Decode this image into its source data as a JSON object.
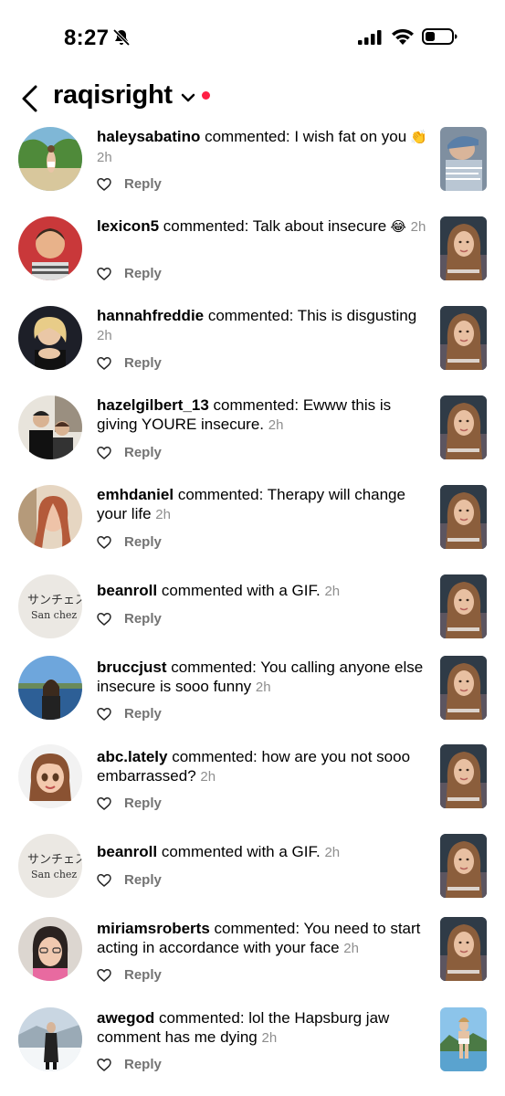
{
  "status_bar": {
    "time": "8:27",
    "silent_icon": "bell-slash-icon",
    "signal_icon": "cellular-signal-icon",
    "wifi_icon": "wifi-icon",
    "battery_icon": "battery-low-icon"
  },
  "header": {
    "back_icon": "chevron-left-icon",
    "title": "raqisright",
    "dropdown_icon": "chevron-down-icon",
    "notification_dot_color": "#ff1f44"
  },
  "colors": {
    "timestamp": "#8e8e8e",
    "reply": "#737373"
  },
  "notifications": [
    {
      "username": "haleysabatino",
      "action": " commented: I wish fat on you",
      "emoji": "👏",
      "time": "2h",
      "reply": "Reply"
    },
    {
      "username": "lexicon5",
      "action": " commented: Talk about insecure",
      "emoji": "😂",
      "time": "2h",
      "reply": "Reply"
    },
    {
      "username": "hannahfreddie",
      "action": " commented: This is disgusting",
      "emoji": "",
      "time": "2h",
      "reply": "Reply"
    },
    {
      "username": "hazelgilbert_13",
      "action": " commented: Ewww this is giving YOURE insecure.",
      "emoji": "",
      "time": "2h",
      "reply": "Reply"
    },
    {
      "username": "emhdaniel",
      "action": " commented: Therapy will change your life",
      "emoji": "",
      "time": "2h",
      "reply": "Reply"
    },
    {
      "username": "beanroll",
      "action": " commented with a GIF.",
      "emoji": "",
      "time": "2h",
      "reply": "Reply"
    },
    {
      "username": "bruccjust",
      "action": " commented: You calling anyone else insecure is sooo funny",
      "emoji": "",
      "time": "2h",
      "reply": "Reply"
    },
    {
      "username": "abc.lately",
      "action": " commented: how are you not sooo embarrassed?",
      "emoji": "",
      "time": "2h",
      "reply": "Reply"
    },
    {
      "username": "beanroll",
      "action": " commented with a GIF.",
      "emoji": "",
      "time": "2h",
      "reply": "Reply"
    },
    {
      "username": "miriamsroberts",
      "action": " commented: You need to start acting in accordance with your face",
      "emoji": "",
      "time": "2h",
      "reply": "Reply"
    },
    {
      "username": "awegod",
      "action": " commented: lol the Hapsburg jaw comment has me dying",
      "emoji": "",
      "time": "2h",
      "reply": "Reply"
    }
  ]
}
